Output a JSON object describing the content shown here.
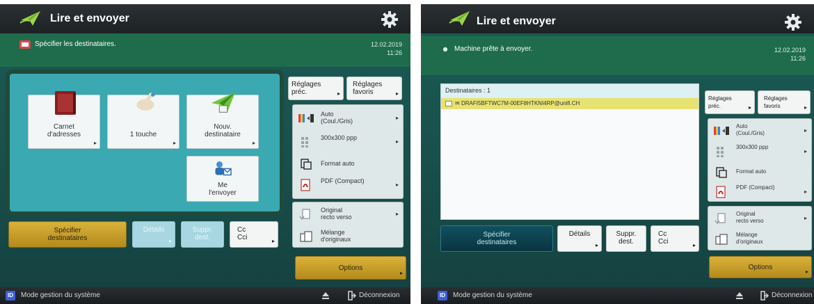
{
  "left": {
    "title": "Lire et envoyer",
    "info": "Spécifier les destinataires.",
    "date": "12.02.2019",
    "time": "11:26",
    "tiles": [
      {
        "label1": "Carnet",
        "label2": "d'adresses"
      },
      {
        "label1": "1 touche",
        "label2": ""
      },
      {
        "label1": "Nouv.",
        "label2": "destinataire"
      },
      {
        "label1": "Me",
        "label2": "l'envoyer"
      }
    ],
    "buttons": {
      "specify1": "Spécifier",
      "specify2": "destinataires",
      "details": "Détails",
      "suppr1": "Suppr.",
      "suppr2": "dest.",
      "cc1": "Cc",
      "cc2": "Cci"
    },
    "right": {
      "reglages1": "Réglages",
      "reglages2": "préc.",
      "favoris1": "Réglages",
      "favoris2": "favoris",
      "color1": "Auto",
      "color2": "(Coul./Gris)",
      "resolution": "300x300 ppp",
      "format": "Format auto",
      "filetype": "PDF (Compact)",
      "original1": "Original",
      "original2": "recto verso",
      "mix1": "Mélange",
      "mix2": "d'originaux",
      "options": "Options"
    },
    "status": {
      "system": "Mode gestion du système",
      "logout": "Déconnexion"
    }
  },
  "right": {
    "title": "Lire et envoyer",
    "info": "Machine prête à envoyer.",
    "date": "12.02.2019",
    "time": "11:26",
    "dest_header": "Destinataires : 1",
    "dest_entry": "DRAFI5BFTWC7M-00EF8HTKNI4RP@unifi.CH",
    "buttons": {
      "specify1": "Spécifier",
      "specify2": "destinataires",
      "details": "Détails",
      "suppr1": "Suppr.",
      "suppr2": "dest.",
      "cc1": "Cc",
      "cc2": "Cci"
    },
    "right": {
      "reglages1": "Réglages",
      "reglages2": "préc.",
      "favoris1": "Réglages",
      "favoris2": "favoris",
      "color1": "Auto",
      "color2": "(Coul./Gris)",
      "resolution": "300x300 ppp",
      "format": "Format auto",
      "filetype": "PDF (Compact)",
      "original1": "Original",
      "original2": "recto verso",
      "mix1": "Mélange",
      "mix2": "d'originaux",
      "options": "Options"
    },
    "status": {
      "system": "Mode gestion du système",
      "logout": "Déconnexion"
    }
  },
  "icons": [
    "paper-plane-icon",
    "gear-icon",
    "address-book-icon",
    "one-touch-icon",
    "new-destination-icon",
    "send-to-myself-icon",
    "color-mode-icon",
    "resolution-icon",
    "auto-format-icon",
    "pdf-icon",
    "duplex-icon",
    "mixed-originals-icon",
    "eject-icon",
    "logout-icon"
  ],
  "colors": {
    "accent_gold": "#c9a12a",
    "teal_panel": "#3aa9b2",
    "infobar_green": "#1f6c4c",
    "dest_highlight": "#e8e272"
  }
}
